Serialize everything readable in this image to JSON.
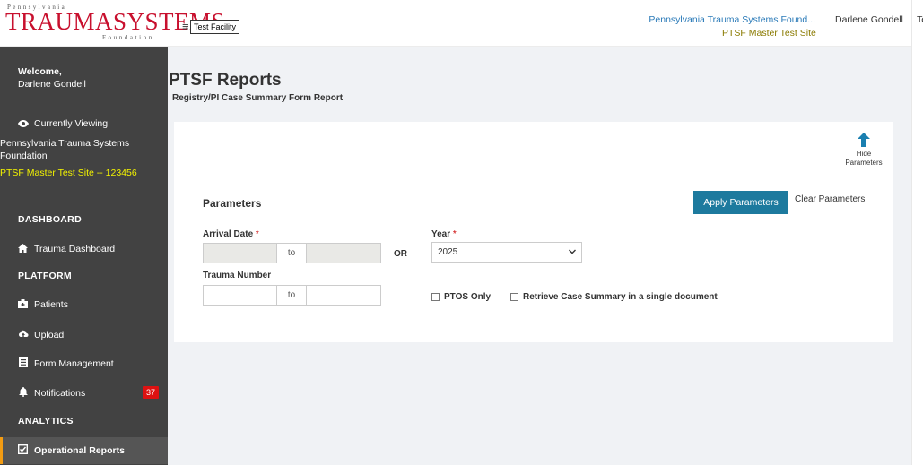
{
  "header": {
    "logo_top": "Pennsylvania",
    "logo_main": "TRAUMASYSTEMS",
    "logo_bottom": "Foundation",
    "menu_icon": "hamburger-icon",
    "facility_label": "Test Facility",
    "org_link": "Pennsylvania Trauma Systems Found...",
    "site_name": "PTSF Master Test Site",
    "user_name": "Darlene Gondell",
    "cut_text": "Te"
  },
  "sidebar": {
    "welcome": "Welcome,",
    "welcome_name": "Darlene Gondell",
    "currently_viewing": "Currently Viewing",
    "cv_org": "Pennsylvania Trauma Systems Foundation",
    "cv_site": "PTSF Master Test Site -- 123456",
    "sections": {
      "dashboard": "DASHBOARD",
      "platform": "PLATFORM",
      "analytics": "ANALYTICS"
    },
    "items": {
      "trauma_dashboard": "Trauma Dashboard",
      "patients": "Patients",
      "upload": "Upload",
      "form_management": "Form Management",
      "notifications": "Notifications",
      "notifications_count": "37",
      "operational_reports": "Operational Reports"
    }
  },
  "main": {
    "title": "PTSF Reports",
    "subtitle": "Registry/PI Case Summary Form Report",
    "hide_parameters": "Hide Parameters",
    "parameters_title": "Parameters",
    "apply_button": "Apply Parameters",
    "clear_button": "Clear Parameters",
    "arrival_date_label": "Arrival Date",
    "required_mark": "*",
    "to_label": "to",
    "or_label": "OR",
    "year_label": "Year",
    "year_value": "2025",
    "trauma_number_label": "Trauma Number",
    "ptos_only": "PTOS Only",
    "retrieve_summary": "Retrieve Case Summary in a single document"
  },
  "colors": {
    "sidebar_bg": "#424242",
    "accent_blue": "#1d7a9e",
    "brand_red": "#c8102e",
    "site_yellow": "#f3f300",
    "active_marker": "#f39c12",
    "badge_red": "#dd1111"
  }
}
